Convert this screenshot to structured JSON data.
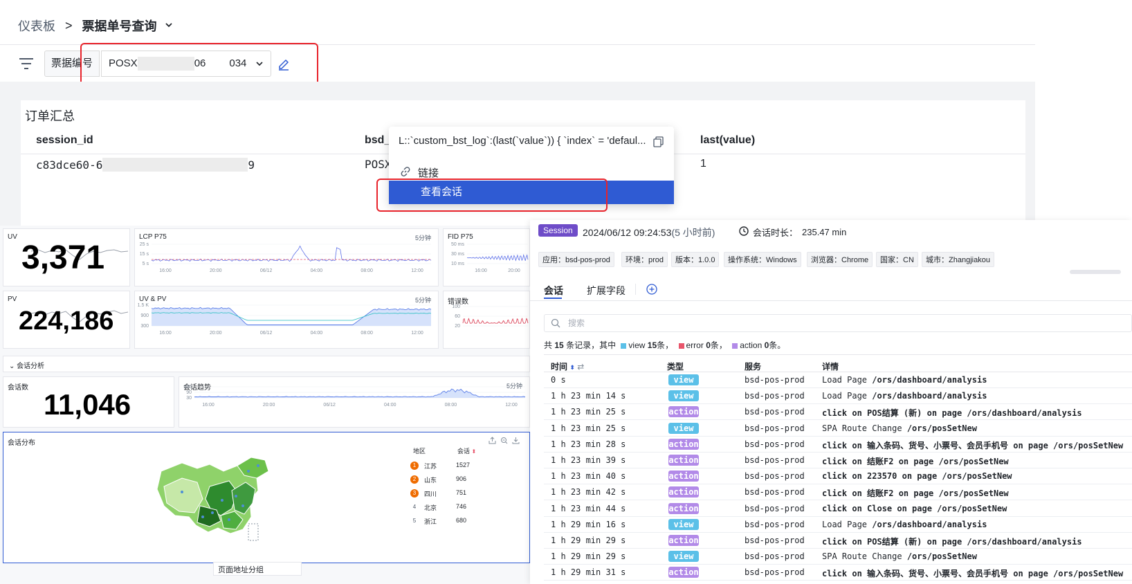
{
  "breadcrumb": {
    "home": "仪表板",
    "separator": ">",
    "current": "票据单号查询"
  },
  "filter": {
    "label": "票据编号",
    "value_start": "POSX",
    "value_mid": "06",
    "value_end": "034"
  },
  "order_card": {
    "title": "订单汇总",
    "columns": [
      "session_id",
      "bsd_i",
      "last(value)"
    ],
    "row": {
      "session_id_start": "c83dce60-6",
      "session_id_end": "9",
      "bsd": "POSX",
      "last_value": "1"
    }
  },
  "popup": {
    "expression": "L::`custom_bst_log`:(last(`value`)) { `index` = 'defaul...",
    "link_label": "链接",
    "view_session_label": "查看会话"
  },
  "dashboard": {
    "uv": {
      "title": "UV",
      "value": "3,371"
    },
    "lcp": {
      "title": "LCP P75",
      "menu": "5分钟",
      "y_ticks": [
        "25 s",
        "15 s",
        "5 s"
      ],
      "x_ticks": [
        "16:00",
        "20:00",
        "06/12",
        "04:00",
        "08:00",
        "12:00"
      ]
    },
    "fid": {
      "title": "FID P75",
      "menu": "5分钟",
      "y_ticks": [
        "50 ms",
        "30 ms",
        "10 ms"
      ],
      "x_ticks": [
        "16:00",
        "20:00"
      ]
    },
    "pv": {
      "title": "PV",
      "value": "224,186"
    },
    "uvpv": {
      "title": "UV & PV",
      "menu": "5分钟",
      "y_ticks": [
        "1.5 K",
        "900",
        "300"
      ],
      "x_ticks": [
        "16:00",
        "20:00",
        "06/12",
        "04:00",
        "08:00",
        "12:00"
      ]
    },
    "errors": {
      "title": "错误数",
      "y_ticks": [
        "100",
        "60",
        "20"
      ]
    },
    "section_title": "会话分析",
    "sessions": {
      "title": "会话数",
      "value": "11,046"
    },
    "trend": {
      "title": "会话趋势",
      "menu": "5分钟",
      "y_ticks": [
        "150",
        "90",
        "30"
      ],
      "x_ticks": [
        "16:00",
        "20:00",
        "06/12",
        "04:00",
        "08:00",
        "12:00"
      ]
    },
    "distribution": {
      "title": "会话分布",
      "col_region": "地区",
      "col_sessions": "会话",
      "rows": [
        {
          "rank": "1",
          "region": "江苏",
          "count": "1527"
        },
        {
          "rank": "2",
          "region": "山东",
          "count": "906"
        },
        {
          "rank": "3",
          "region": "四川",
          "count": "751"
        },
        {
          "rank": "4",
          "region": "北京",
          "count": "746"
        },
        {
          "rank": "5",
          "region": "浙江",
          "count": "680"
        }
      ]
    },
    "bottom_fragment": "页面地址分组"
  },
  "session": {
    "badge": "Session",
    "datetime": "2024/06/12 09:24:53",
    "relative": "(5 小时前)",
    "duration_label": "会话时长：",
    "duration_value": "235.47 min",
    "tags": [
      "应用：bsd-pos-prod",
      "环境：prod",
      "版本：1.0.0",
      "操作系统：Windows",
      "浏览器：Chrome",
      "国家：CN",
      "城市：Zhangjiakou"
    ],
    "tab_active": "会话",
    "tab_other": "扩展字段",
    "search_placeholder": "搜索",
    "summary": {
      "prefix": "共",
      "total": "15",
      "mid": "条记录，其中",
      "view_label": "view",
      "view_count": "15",
      "unit": "条，",
      "error_label": "error",
      "error_count": "0",
      "action_label": "action",
      "action_count": "0",
      "end": "条。"
    },
    "columns": {
      "time": "时间",
      "type": "类型",
      "service": "服务",
      "detail": "详情"
    },
    "rows": [
      {
        "time": "0 s",
        "type": "view",
        "service": "bsd-pos-prod",
        "detail_pre": "Load Page ",
        "detail_bold": "/ors/dashboard/analysis",
        "detail_post": ""
      },
      {
        "time": "1 h 23 min 14 s",
        "type": "view",
        "service": "bsd-pos-prod",
        "detail_pre": "Load Page ",
        "detail_bold": "/ors/dashboard/analysis",
        "detail_post": ""
      },
      {
        "time": "1 h 23 min 25 s",
        "type": "action",
        "service": "bsd-pos-prod",
        "detail_pre": "",
        "detail_bold": "click on POS结算 (新)  on page /ors/dashboard/analysis",
        "detail_post": ""
      },
      {
        "time": "1 h 23 min 25 s",
        "type": "view",
        "service": "bsd-pos-prod",
        "detail_pre": "SPA Route Change ",
        "detail_bold": "/ors/posSetNew",
        "detail_post": ""
      },
      {
        "time": "1 h 23 min 28 s",
        "type": "action",
        "service": "bsd-pos-prod",
        "detail_pre": "",
        "detail_bold": "click on 输入条码、货号、小票号、会员手机号 on page /ors/posSetNew",
        "detail_post": ""
      },
      {
        "time": "1 h 23 min 39 s",
        "type": "action",
        "service": "bsd-pos-prod",
        "detail_pre": "",
        "detail_bold": "click on 结账F2 on page /ors/posSetNew",
        "detail_post": ""
      },
      {
        "time": "1 h 23 min 40 s",
        "type": "action",
        "service": "bsd-pos-prod",
        "detail_pre": "",
        "detail_bold": "click on 223570 on page /ors/posSetNew",
        "detail_post": ""
      },
      {
        "time": "1 h 23 min 42 s",
        "type": "action",
        "service": "bsd-pos-prod",
        "detail_pre": "",
        "detail_bold": "click on 结账F2 on page /ors/posSetNew",
        "detail_post": ""
      },
      {
        "time": "1 h 23 min 44 s",
        "type": "action",
        "service": "bsd-pos-prod",
        "detail_pre": "",
        "detail_bold": "click on Close on page /ors/posSetNew",
        "detail_post": ""
      },
      {
        "time": "1 h 29 min 16 s",
        "type": "view",
        "service": "bsd-pos-prod",
        "detail_pre": "Load Page ",
        "detail_bold": "/ors/dashboard/analysis",
        "detail_post": ""
      },
      {
        "time": "1 h 29 min 29 s",
        "type": "action",
        "service": "bsd-pos-prod",
        "detail_pre": "",
        "detail_bold": "click on POS结算 (新)  on page /ors/dashboard/analysis",
        "detail_post": ""
      },
      {
        "time": "1 h 29 min 29 s",
        "type": "view",
        "service": "bsd-pos-prod",
        "detail_pre": "SPA Route Change ",
        "detail_bold": "/ors/posSetNew",
        "detail_post": ""
      },
      {
        "time": "1 h 29 min 31 s",
        "type": "action",
        "service": "bsd-pos-prod",
        "detail_pre": "",
        "detail_bold": "click on 输入条码、货号、小票号、会员手机号 on page /ors/posSetNew",
        "detail_post": ""
      }
    ],
    "colors": {
      "view": "#5bc0e8",
      "action": "#b28ae8",
      "error": "#e8556b",
      "badge": "#6e4cc8",
      "accent": "#2f5bd3",
      "highlight": "#e8232b"
    }
  }
}
